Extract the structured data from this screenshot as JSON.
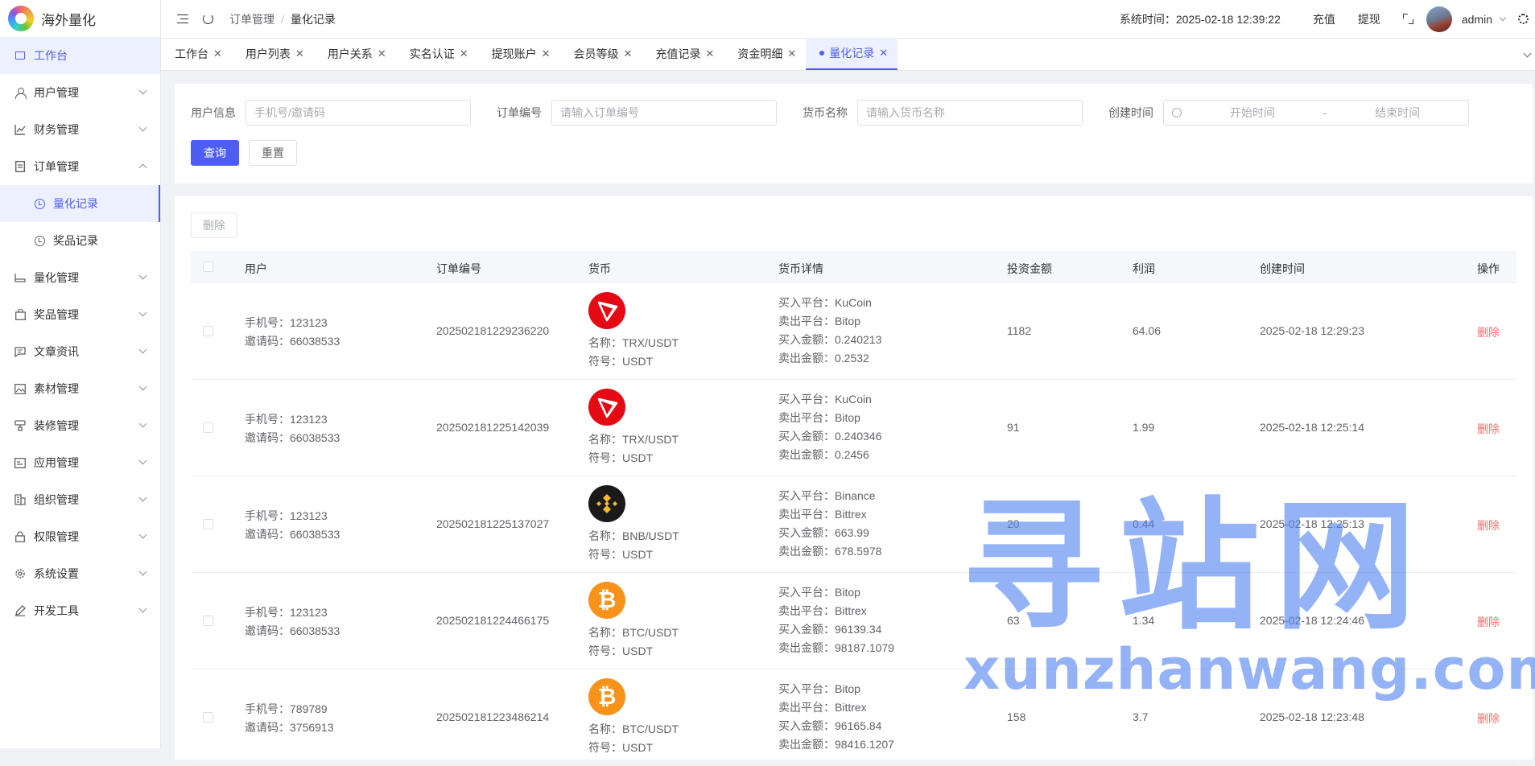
{
  "app": {
    "title": "海外量化"
  },
  "sidebar": {
    "items": [
      {
        "label": "工作台",
        "icon": "monitor-icon",
        "active": true
      },
      {
        "label": "用户管理",
        "icon": "user-icon"
      },
      {
        "label": "财务管理",
        "icon": "chart-icon"
      },
      {
        "label": "订单管理",
        "icon": "order-icon",
        "expanded": true
      },
      {
        "label": "量化记录",
        "icon": "clock-icon",
        "sub": true,
        "active": true
      },
      {
        "label": "奖品记录",
        "icon": "clock-icon",
        "sub": true
      },
      {
        "label": "量化管理",
        "icon": "quant-icon"
      },
      {
        "label": "奖品管理",
        "icon": "bag-icon"
      },
      {
        "label": "文章资讯",
        "icon": "article-icon"
      },
      {
        "label": "素材管理",
        "icon": "image-icon"
      },
      {
        "label": "装修管理",
        "icon": "decor-icon"
      },
      {
        "label": "应用管理",
        "icon": "app-icon"
      },
      {
        "label": "组织管理",
        "icon": "org-icon"
      },
      {
        "label": "权限管理",
        "icon": "lock-icon"
      },
      {
        "label": "系统设置",
        "icon": "gear-icon"
      },
      {
        "label": "开发工具",
        "icon": "pen-icon"
      }
    ]
  },
  "topbar": {
    "breadcrumb": [
      "订单管理",
      "量化记录"
    ],
    "system_time": "系统时间：2025-02-18 12:39:22",
    "recharge": "充值",
    "withdraw": "提现",
    "user": "admin"
  },
  "tabs": [
    {
      "label": "工作台"
    },
    {
      "label": "用户列表"
    },
    {
      "label": "用户关系"
    },
    {
      "label": "实名认证"
    },
    {
      "label": "提现账户"
    },
    {
      "label": "会员等级"
    },
    {
      "label": "充值记录"
    },
    {
      "label": "资金明细"
    },
    {
      "label": "量化记录",
      "active": true
    }
  ],
  "filters": {
    "user_label": "用户信息",
    "user_placeholder": "手机号/邀请码",
    "order_label": "订单编号",
    "order_placeholder": "请输入订单编号",
    "coin_label": "货币名称",
    "coin_placeholder": "请输入货币名称",
    "date_label": "创建时间",
    "date_start": "开始时间",
    "date_sep": "-",
    "date_end": "结束时间",
    "query_button": "查询",
    "reset_button": "重置"
  },
  "table": {
    "delete_button": "删除",
    "columns": [
      "用户",
      "订单编号",
      "货币",
      "货币详情",
      "投资金额",
      "利润",
      "创建时间",
      "操作"
    ],
    "rows": [
      {
        "phone": "手机号：123123",
        "invite": "邀请码：66038533",
        "order_no": "202502181229236220",
        "coin_icon": "tron-icon",
        "coin_name": "名称：TRX/USDT",
        "coin_symbol": "符号：USDT",
        "buy_platform": "买入平台：KuCoin",
        "sell_platform": "卖出平台：Bitop",
        "buy_amount": "买入金额：0.240213",
        "sell_amount": "卖出金额：0.2532",
        "investment": "1182",
        "profit": "64.06",
        "created": "2025-02-18 12:29:23",
        "action": "删除"
      },
      {
        "phone": "手机号：123123",
        "invite": "邀请码：66038533",
        "order_no": "202502181225142039",
        "coin_icon": "tron-icon",
        "coin_name": "名称：TRX/USDT",
        "coin_symbol": "符号：USDT",
        "buy_platform": "买入平台：KuCoin",
        "sell_platform": "卖出平台：Bitop",
        "buy_amount": "买入金额：0.240346",
        "sell_amount": "卖出金额：0.2456",
        "investment": "91",
        "profit": "1.99",
        "created": "2025-02-18 12:25:14",
        "action": "删除"
      },
      {
        "phone": "手机号：123123",
        "invite": "邀请码：66038533",
        "order_no": "202502181225137027",
        "coin_icon": "bnb-icon",
        "coin_name": "名称：BNB/USDT",
        "coin_symbol": "符号：USDT",
        "buy_platform": "买入平台：Binance",
        "sell_platform": "卖出平台：Bittrex",
        "buy_amount": "买入金额：663.99",
        "sell_amount": "卖出金额：678.5978",
        "investment": "20",
        "profit": "0.44",
        "created": "2025-02-18 12:25:13",
        "action": "删除"
      },
      {
        "phone": "手机号：123123",
        "invite": "邀请码：66038533",
        "order_no": "202502181224466175",
        "coin_icon": "bitcoin-icon",
        "coin_name": "名称：BTC/USDT",
        "coin_symbol": "符号：USDT",
        "buy_platform": "买入平台：Bitop",
        "sell_platform": "卖出平台：Bittrex",
        "buy_amount": "买入金额：96139.34",
        "sell_amount": "卖出金额：98187.1079",
        "investment": "63",
        "profit": "1.34",
        "created": "2025-02-18 12:24:46",
        "action": "删除"
      },
      {
        "phone": "手机号：789789",
        "invite": "邀请码：3756913",
        "order_no": "202502181223486214",
        "coin_icon": "bitcoin-icon",
        "coin_name": "名称：BTC/USDT",
        "coin_symbol": "符号：USDT",
        "buy_platform": "买入平台：Bitop",
        "sell_platform": "卖出平台：Bittrex",
        "buy_amount": "买入金额：96165.84",
        "sell_amount": "卖出金额：98416.1207",
        "investment": "158",
        "profit": "3.7",
        "created": "2025-02-18 12:23:48",
        "action": "删除"
      }
    ]
  },
  "watermark": {
    "big": "寻站网",
    "small": "xunzhanwang.com"
  },
  "colors": {
    "primary": "#4e5ef4",
    "danger": "#f56c6c",
    "tron": "#e50914",
    "bnb_gold": "#f3ba2f",
    "btc": "#f7931a"
  }
}
